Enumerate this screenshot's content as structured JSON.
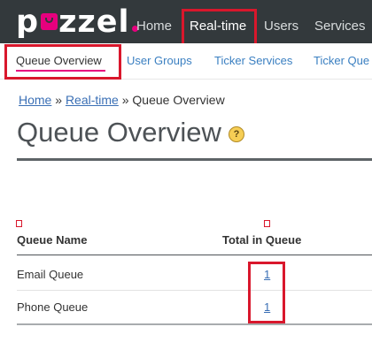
{
  "brand": {
    "logo_text_start": "p",
    "logo_text_end": "zzel"
  },
  "topnav": {
    "items": [
      {
        "label": "Home"
      },
      {
        "label": "Real-time"
      },
      {
        "label": "Users"
      },
      {
        "label": "Services"
      }
    ],
    "active": "Real-time"
  },
  "subnav": {
    "items": [
      {
        "label": "Queue Overview"
      },
      {
        "label": "User Groups"
      },
      {
        "label": "Ticker Services"
      },
      {
        "label": "Ticker Que"
      }
    ],
    "active": "Queue Overview"
  },
  "breadcrumb": {
    "home": "Home",
    "sep1": "»",
    "realtime": "Real-time",
    "sep2": "»",
    "current": "Queue Overview"
  },
  "page": {
    "title": "Queue Overview",
    "help_glyph": "?"
  },
  "table": {
    "columns": [
      "Queue Name",
      "Total in Queue"
    ],
    "rows": [
      {
        "name": "Email Queue",
        "total": "1"
      },
      {
        "name": "Phone Queue",
        "total": "1"
      }
    ]
  },
  "colors": {
    "brand_pink": "#e6007e",
    "topbar_bg": "#33393c",
    "link_blue": "#3a7fc1",
    "highlight_red": "#d9172c"
  }
}
